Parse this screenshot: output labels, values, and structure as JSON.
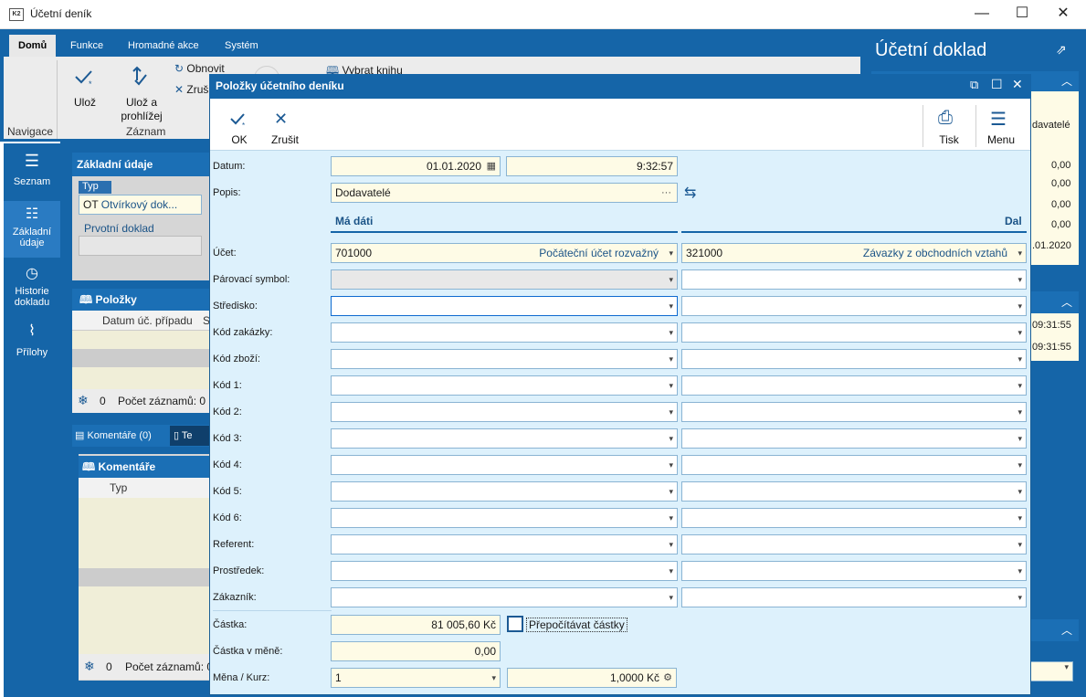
{
  "window": {
    "title": "Účetní deník",
    "app_icon_text": "K2",
    "minimize": "—",
    "maximize": "☐",
    "close": "✕"
  },
  "ribbon": {
    "tabs": [
      "Domů",
      "Funkce",
      "Hromadné akce",
      "Systém"
    ],
    "buttons": {
      "save": "Ulož",
      "save_view_1": "Ulož a",
      "save_view_2": "prohlížej",
      "refresh": "Obnovit",
      "cancel": "Zruš",
      "select_book": "Vybrat knihu"
    },
    "groups": {
      "nav": "Navigace",
      "record": "Záznam"
    }
  },
  "leftnav": {
    "items": [
      {
        "label": "Seznam"
      },
      {
        "label1": "Základní",
        "label2": "údaje"
      },
      {
        "label1": "Historie",
        "label2": "dokladu"
      },
      {
        "label": "Přílohy"
      }
    ]
  },
  "background": {
    "basic_title": "Základní údaje",
    "type_label": "Typ",
    "type_value": "OT",
    "type_text": "Otvírkový dok...",
    "primary_doc_label": "Prvotní doklad",
    "items_title": "Položky",
    "items_col": "Datum úč. případu",
    "items_col2": "S",
    "items_count_num": "0",
    "items_count": "Počet záznamů: 0",
    "comments_tab": "Komentáře (0)",
    "text_tab": "Te",
    "comments_title": "Komentáře",
    "comments_col": "Typ",
    "comments_count_num": "0",
    "comments_count": "Počet záznamů: 0"
  },
  "rightpanel": {
    "title": "Účetní doklad",
    "text_vendor": "davatelé",
    "values": [
      "0,00",
      "0,00",
      "0,00",
      "0,00"
    ],
    "date": ".01.2020",
    "times": [
      "09:31:55",
      "09:31:55"
    ]
  },
  "dialog": {
    "title": "Položky účetního deníku",
    "toolbar": {
      "ok": "OK",
      "cancel": "Zrušit",
      "print": "Tisk",
      "menu": "Menu"
    },
    "labels": {
      "date": "Datum:",
      "desc": "Popis:",
      "account": "Účet:",
      "pair": "Párovací symbol:",
      "center": "Středisko:",
      "order": "Kód zakázky:",
      "goods": "Kód zboží:",
      "c1": "Kód 1:",
      "c2": "Kód 2:",
      "c3": "Kód 3:",
      "c4": "Kód 4:",
      "c5": "Kód 5:",
      "c6": "Kód 6:",
      "referent": "Referent:",
      "means": "Prostředek:",
      "customer": "Zákazník:",
      "amount": "Částka:",
      "amount_cur": "Částka v měně:",
      "currency": "Měna / Kurz:"
    },
    "values": {
      "date": "01.01.2020",
      "time": "9:32:57",
      "desc": "Dodavatelé",
      "desc_more": "···",
      "md_header": "Má dáti",
      "dal_header": "Dal",
      "md_account": "701000",
      "md_account_name": "Počáteční účet rozvažný",
      "dal_account": "321000",
      "dal_account_name": "Závazky z obchodních vztahů",
      "amount": "81 005,60 Kč",
      "recalc": "Přepočítávat částky",
      "amount_cur": "0,00",
      "currency": "1",
      "rate": "1,0000 Kč"
    }
  }
}
